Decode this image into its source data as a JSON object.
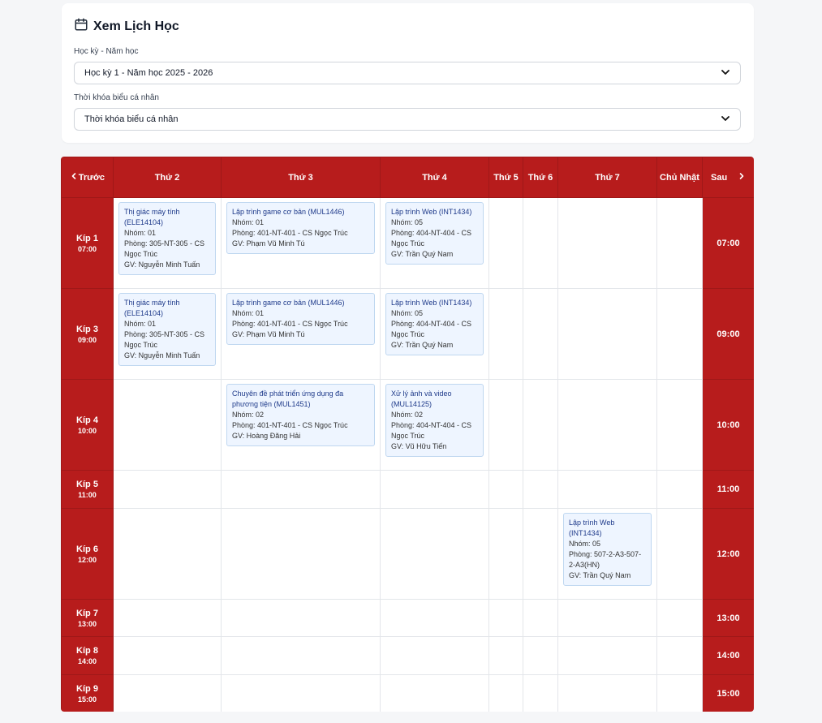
{
  "header": {
    "title": "Xem Lịch Học"
  },
  "filters": {
    "semester_label": "Học kỳ - Năm học",
    "semester_value": "Học kỳ 1 - Năm học 2025 - 2026",
    "schedule_label": "Thời khóa biểu cá nhân",
    "schedule_value": "Thời khóa biểu cá nhân"
  },
  "nav": {
    "prev": "Trước",
    "next": "Sau"
  },
  "days": [
    "Thứ 2",
    "Thứ 3",
    "Thứ 4",
    "Thứ 5",
    "Thứ 6",
    "Thứ 7",
    "Chủ Nhật"
  ],
  "slots": [
    {
      "kip": "Kíp 1",
      "start": "07:00",
      "time": "07:00"
    },
    {
      "kip": "Kíp 3",
      "start": "09:00",
      "time": "09:00"
    },
    {
      "kip": "Kíp 4",
      "start": "10:00",
      "time": "10:00"
    },
    {
      "kip": "Kíp 5",
      "start": "11:00",
      "time": "11:00"
    },
    {
      "kip": "Kíp 6",
      "start": "12:00",
      "time": "12:00"
    },
    {
      "kip": "Kíp 7",
      "start": "13:00",
      "time": "13:00"
    },
    {
      "kip": "Kíp 8",
      "start": "14:00",
      "time": "14:00"
    },
    {
      "kip": "Kíp 9",
      "start": "15:00",
      "time": "15:00"
    }
  ],
  "courses": [
    {
      "slot": 0,
      "day": 0,
      "name": "Thị giác máy tính (ELE14104)",
      "group": "Nhóm: 01",
      "room": "Phòng: 305-NT-305 - CS Ngọc Trúc",
      "teacher": "GV: Nguyễn Minh Tuấn"
    },
    {
      "slot": 0,
      "day": 1,
      "name": "Lập trình game cơ bản (MUL1446)",
      "group": "Nhóm: 01",
      "room": "Phòng: 401-NT-401 - CS Ngọc Trúc",
      "teacher": "GV: Phạm Vũ Minh Tú"
    },
    {
      "slot": 0,
      "day": 2,
      "name": "Lập trình Web (INT1434)",
      "group": "Nhóm: 05",
      "room": "Phòng: 404-NT-404 - CS Ngọc Trúc",
      "teacher": "GV: Trần Quý Nam"
    },
    {
      "slot": 1,
      "day": 0,
      "name": "Thị giác máy tính (ELE14104)",
      "group": "Nhóm: 01",
      "room": "Phòng: 305-NT-305 - CS Ngọc Trúc",
      "teacher": "GV: Nguyễn Minh Tuấn"
    },
    {
      "slot": 1,
      "day": 1,
      "name": "Lập trình game cơ bản (MUL1446)",
      "group": "Nhóm: 01",
      "room": "Phòng: 401-NT-401 - CS Ngọc Trúc",
      "teacher": "GV: Phạm Vũ Minh Tú"
    },
    {
      "slot": 1,
      "day": 2,
      "name": "Lập trình Web (INT1434)",
      "group": "Nhóm: 05",
      "room": "Phòng: 404-NT-404 - CS Ngọc Trúc",
      "teacher": "GV: Trần Quý Nam"
    },
    {
      "slot": 2,
      "day": 1,
      "name": "Chuyên đề phát triển ứng dụng đa phương tiện (MUL1451)",
      "group": "Nhóm: 02",
      "room": "Phòng: 401-NT-401 - CS Ngọc Trúc",
      "teacher": "GV: Hoàng Đăng Hải"
    },
    {
      "slot": 2,
      "day": 2,
      "name": "Xử lý ảnh và video (MUL14125)",
      "group": "Nhóm: 02",
      "room": "Phòng: 404-NT-404 - CS Ngọc Trúc",
      "teacher": "GV: Vũ Hữu Tiến"
    },
    {
      "slot": 4,
      "day": 5,
      "name": "Lập trình Web (INT1434)",
      "group": "Nhóm: 05",
      "room": "Phòng: 507-2-A3-507-2-A3(HN)",
      "teacher": "GV: Trần Quý Nam"
    }
  ],
  "colors": {
    "accent": "#b71c1c",
    "course_bg": "#eef5ff",
    "course_border": "#bfd7f0",
    "course_title": "#1e3a8a"
  },
  "icons": {
    "title": "calendar-icon",
    "prev": "chevron-left-icon",
    "next": "chevron-right-icon",
    "select": "chevron-down-icon"
  }
}
